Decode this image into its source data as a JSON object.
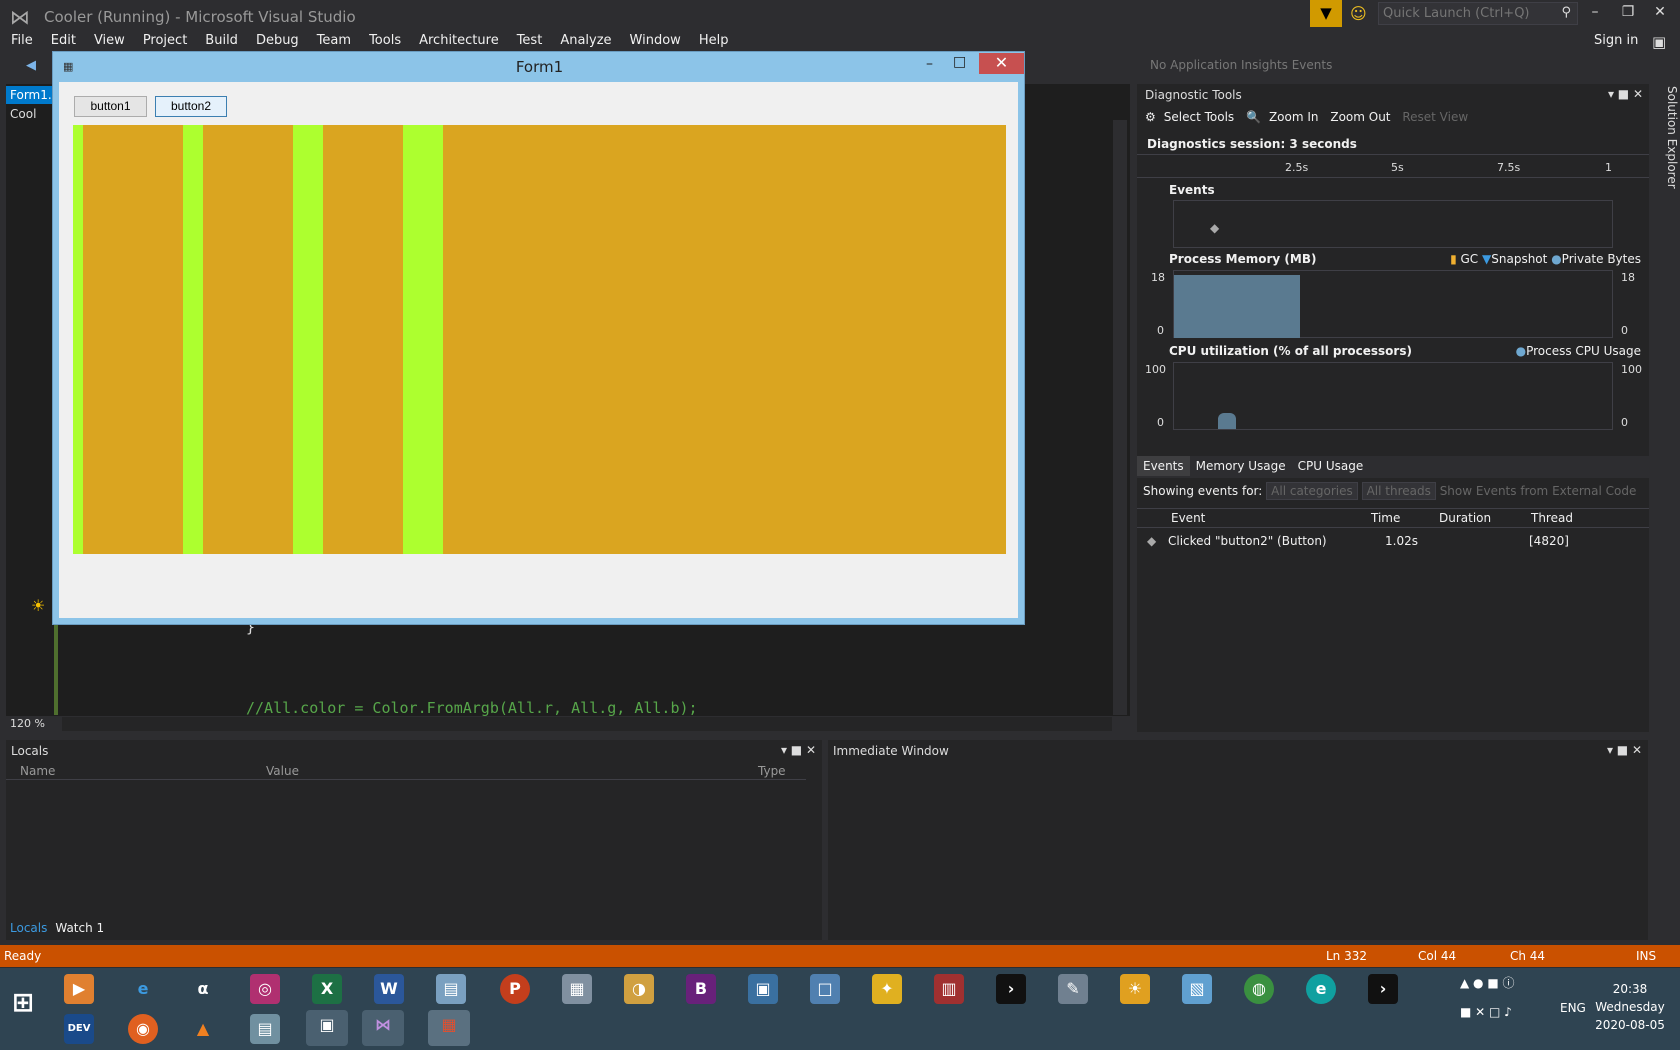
{
  "app": {
    "title": "Cooler (Running) - Microsoft Visual Studio",
    "quick_launch_placeholder": "Quick Launch (Ctrl+Q)",
    "sign_in": "Sign in"
  },
  "menu": [
    "File",
    "Edit",
    "View",
    "Project",
    "Build",
    "Debug",
    "Team",
    "Tools",
    "Architecture",
    "Test",
    "Analyze",
    "Window",
    "Help"
  ],
  "toolbar": {
    "insights": "No Application Insights Events"
  },
  "editor": {
    "tab": "Form1.c",
    "nav": "Cool",
    "brace": "}",
    "comment": "//All.color = Color.FromArgb(All.r, All.g, All.b);",
    "zoom": "120 %"
  },
  "form1": {
    "title": "Form1",
    "button1": "button1",
    "button2": "button2",
    "close": "✕",
    "canvas_color": "#daa520",
    "stripe_color": "#adff2f"
  },
  "diag": {
    "title": "Diagnostic Tools",
    "select_tools": "Select Tools",
    "zoom_in": "Zoom In",
    "zoom_out": "Zoom Out",
    "reset_view": "Reset View",
    "session": "Diagnostics session: 3 seconds",
    "ticks": [
      "2.5s",
      "5s",
      "7.5s",
      "1"
    ],
    "events_label": "Events",
    "memory_label": "Process Memory (MB)",
    "memory_legend": [
      "GC",
      "Snapshot",
      "Private Bytes"
    ],
    "memory_max": "18",
    "memory_min": "0",
    "cpu_label": "CPU utilization (% of all processors)",
    "cpu_legend": "Process CPU Usage",
    "cpu_max": "100",
    "cpu_min": "0",
    "tabs": [
      "Events",
      "Memory Usage",
      "CPU Usage"
    ],
    "showing_label": "Showing events for:",
    "filter_categories": "All categories",
    "filter_threads": "All threads",
    "external_code": "Show Events from External Code",
    "columns": [
      "Event",
      "Time",
      "Duration",
      "Thread"
    ],
    "row": {
      "event": "Clicked \"button2\" (Button)",
      "time": "1.02s",
      "duration": "",
      "thread": "[4820]"
    }
  },
  "side": {
    "solution_explorer": "Solution Explorer"
  },
  "locals": {
    "title": "Locals",
    "columns": [
      "Name",
      "Value",
      "Type"
    ],
    "tabs": [
      "Locals",
      "Watch 1"
    ]
  },
  "immediate": {
    "title": "Immediate Window"
  },
  "status": {
    "ready": "Ready",
    "ln": "Ln 332",
    "col": "Col 44",
    "ch": "Ch 44",
    "ins": "INS"
  },
  "taskbar": {
    "lang": "ENG",
    "time": "20:38",
    "day": "Wednesday",
    "date": "2020-08-05"
  }
}
